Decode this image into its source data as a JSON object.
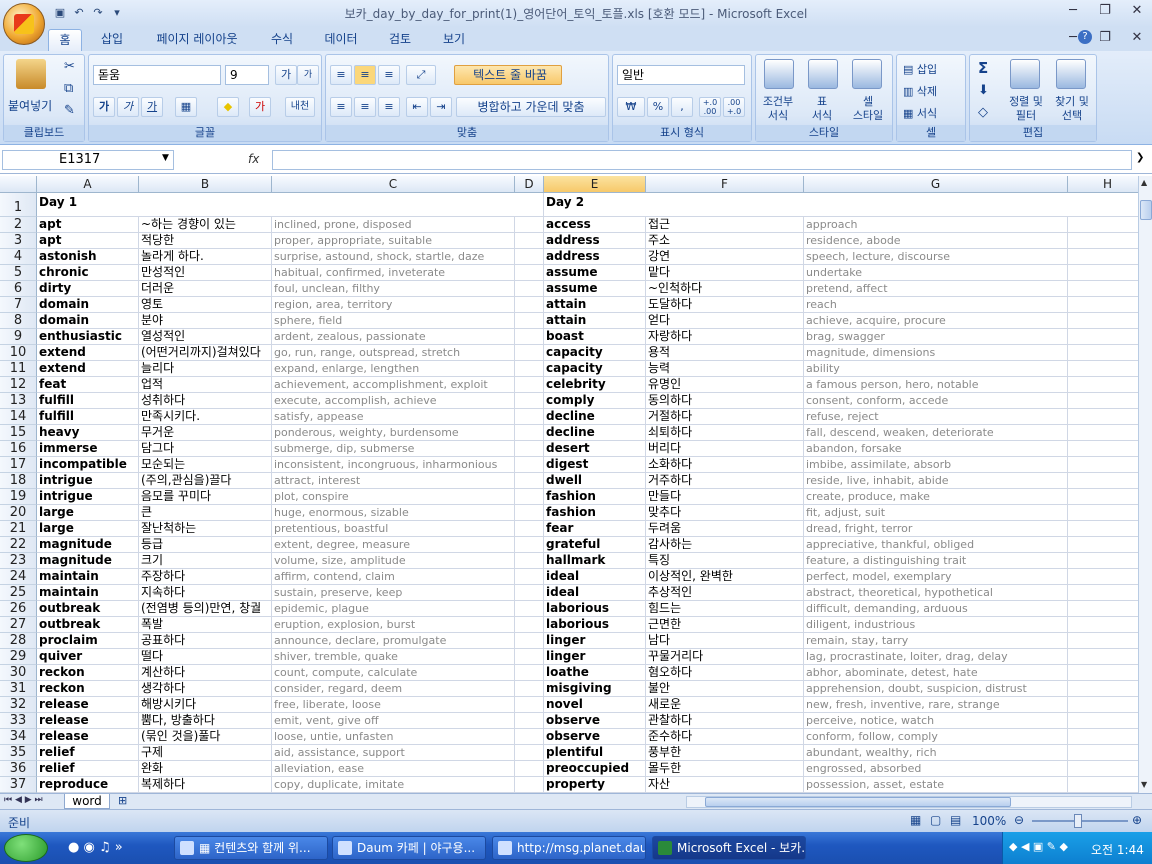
{
  "window": {
    "title": "보카_day_by_day_for_print(1)_영어단어_토익_토플.xls  [호환 모드] - Microsoft Excel"
  },
  "tabs": [
    "홈",
    "삽입",
    "페이지 레이아웃",
    "수식",
    "데이터",
    "검토",
    "보기"
  ],
  "ribbon": {
    "clipboard": {
      "label": "클립보드",
      "paste": "붙여넣기"
    },
    "font": {
      "label": "글꼴",
      "name": "돋움",
      "size": "9",
      "bold": "가",
      "italic": "가",
      "underline": "가",
      "phonetic": "내천"
    },
    "align": {
      "label": "맞춤",
      "wrap": "텍스트 줄 바꿈",
      "merge": "병합하고 가운데 맞춤"
    },
    "number": {
      "label": "표시 형식",
      "format": "일반",
      "currency": "₩",
      "percent": "%",
      "comma": ",",
      "inc": "+.0 .00",
      "dec": ".00 +.0"
    },
    "styles": {
      "label": "스타일",
      "cond": "조건부\n서식",
      "table": "표\n서식",
      "cell": "셀\n스타일"
    },
    "cells": {
      "label": "셀",
      "insert": "삽입",
      "delete": "삭제",
      "format": "서식"
    },
    "edit": {
      "label": "편집",
      "sum": "Σ",
      "sort": "정렬 및\n필터",
      "find": "찾기 및\n선택"
    }
  },
  "namebox": "E1317",
  "fx": "fx",
  "columns": [
    "A",
    "B",
    "C",
    "D",
    "E",
    "F",
    "G",
    "H"
  ],
  "header_row": {
    "a": "Day 1",
    "e": "Day 2"
  },
  "rows": [
    [
      "apt",
      "~하는 경향이 있는",
      "inclined, prone, disposed",
      "access",
      "접근",
      "approach"
    ],
    [
      "apt",
      "적당한",
      "proper, appropriate, suitable",
      "address",
      "주소",
      "residence, abode"
    ],
    [
      "astonish",
      "놀라게 하다.",
      "surprise, astound, shock, startle, daze",
      "address",
      "강연",
      "speech, lecture, discourse"
    ],
    [
      "chronic",
      "만성적인",
      "habitual, confirmed, inveterate",
      "assume",
      "맡다",
      "undertake"
    ],
    [
      "dirty",
      "더러운",
      "foul, unclean, filthy",
      "assume",
      "~인척하다",
      "pretend, affect"
    ],
    [
      "domain",
      "영토",
      "region, area, territory",
      "attain",
      "도달하다",
      "reach"
    ],
    [
      "domain",
      "분야",
      "sphere, field",
      "attain",
      "얻다",
      "achieve, acquire, procure"
    ],
    [
      "enthusiastic",
      "열성적인",
      "ardent, zealous, passionate",
      "boast",
      "자랑하다",
      "brag, swagger"
    ],
    [
      "extend",
      "(어떤거리까지)걸쳐있다",
      "go, run, range, outspread, stretch",
      "capacity",
      "용적",
      "magnitude, dimensions"
    ],
    [
      "extend",
      "늘리다",
      "expand, enlarge, lengthen",
      "capacity",
      "능력",
      "ability"
    ],
    [
      "feat",
      "업적",
      "achievement, accomplishment, exploit",
      "celebrity",
      "유명인",
      "a famous person, hero, notable"
    ],
    [
      "fulfill",
      "성취하다",
      "execute, accomplish, achieve",
      "comply",
      "동의하다",
      "consent, conform, accede"
    ],
    [
      "fulfill",
      "만족시키다.",
      "satisfy, appease",
      "decline",
      "거절하다",
      "refuse, reject"
    ],
    [
      "heavy",
      "무거운",
      "ponderous, weighty, burdensome",
      "decline",
      "쇠퇴하다",
      "fall, descend, weaken, deteriorate"
    ],
    [
      "immerse",
      "담그다",
      "submerge, dip, submerse",
      "desert",
      "버리다",
      "abandon, forsake"
    ],
    [
      "incompatible",
      "모순되는",
      "inconsistent, incongruous, inharmonious",
      "digest",
      "소화하다",
      "imbibe, assimilate, absorb"
    ],
    [
      "intrigue",
      "(주의,관심을)끌다",
      "attract, interest",
      "dwell",
      "거주하다",
      "reside, live, inhabit, abide"
    ],
    [
      "intrigue",
      "음모를 꾸미다",
      "plot, conspire",
      "fashion",
      "만들다",
      "create, produce, make"
    ],
    [
      "large",
      "큰",
      "huge, enormous, sizable",
      "fashion",
      "맞추다",
      "fit, adjust, suit"
    ],
    [
      "large",
      "잘난척하는",
      "pretentious, boastful",
      "fear",
      "두려움",
      "dread, fright, terror"
    ],
    [
      "magnitude",
      "등급",
      "extent, degree, measure",
      "grateful",
      "감사하는",
      "appreciative, thankful, obliged"
    ],
    [
      "magnitude",
      "크기",
      "volume, size, amplitude",
      "hallmark",
      "특징",
      "feature, a distinguishing trait"
    ],
    [
      "maintain",
      "주장하다",
      "affirm, contend, claim",
      "ideal",
      "이상적인, 완벽한",
      "perfect, model, exemplary"
    ],
    [
      "maintain",
      "지속하다",
      "sustain, preserve, keep",
      "ideal",
      "추상적인",
      "abstract, theoretical, hypothetical"
    ],
    [
      "outbreak",
      "(전염병 등의)만연, 창궐",
      "epidemic, plague",
      "laborious",
      "힘드는",
      "difficult, demanding, arduous"
    ],
    [
      "outbreak",
      "폭발",
      "eruption, explosion, burst",
      "laborious",
      "근면한",
      "diligent, industrious"
    ],
    [
      "proclaim",
      "공표하다",
      "announce, declare, promulgate",
      "linger",
      "남다",
      "remain, stay, tarry"
    ],
    [
      "quiver",
      "떨다",
      "shiver, tremble, quake",
      "linger",
      "꾸물거리다",
      "lag, procrastinate, loiter, drag, delay"
    ],
    [
      "reckon",
      "계산하다",
      "count, compute, calculate",
      "loathe",
      "혐오하다",
      "abhor, abominate, detest, hate"
    ],
    [
      "reckon",
      "생각하다",
      "consider, regard, deem",
      "misgiving",
      "불안",
      "apprehension, doubt, suspicion, distrust"
    ],
    [
      "release",
      "해방시키다",
      "free, liberate, loose",
      "novel",
      "새로운",
      "new, fresh, inventive, rare, strange"
    ],
    [
      "release",
      "뿜다, 방출하다",
      "emit, vent, give off",
      "observe",
      "관찰하다",
      "perceive, notice, watch"
    ],
    [
      "release",
      "(묶인 것을)풀다",
      "loose, untie, unfasten",
      "observe",
      "준수하다",
      "conform, follow, comply"
    ],
    [
      "relief",
      "구제",
      "aid, assistance, support",
      "plentiful",
      "풍부한",
      "abundant, wealthy, rich"
    ],
    [
      "relief",
      "완화",
      "alleviation, ease",
      "preoccupied",
      "몰두한",
      "engrossed, absorbed"
    ],
    [
      "reproduce",
      "복제하다",
      "copy, duplicate, imitate",
      "property",
      "자산",
      "possession, asset, estate"
    ]
  ],
  "sheet_tab": "word",
  "status": {
    "left": "준비",
    "zoom": "100%"
  },
  "taskbar": {
    "items": [
      "▦ 컨텐츠와 함께 위...",
      "Daum 카페 | 야구용...",
      "http://msg.planet.dau...",
      "Microsoft Excel - 보카..."
    ],
    "clock": "오전 1:44"
  }
}
